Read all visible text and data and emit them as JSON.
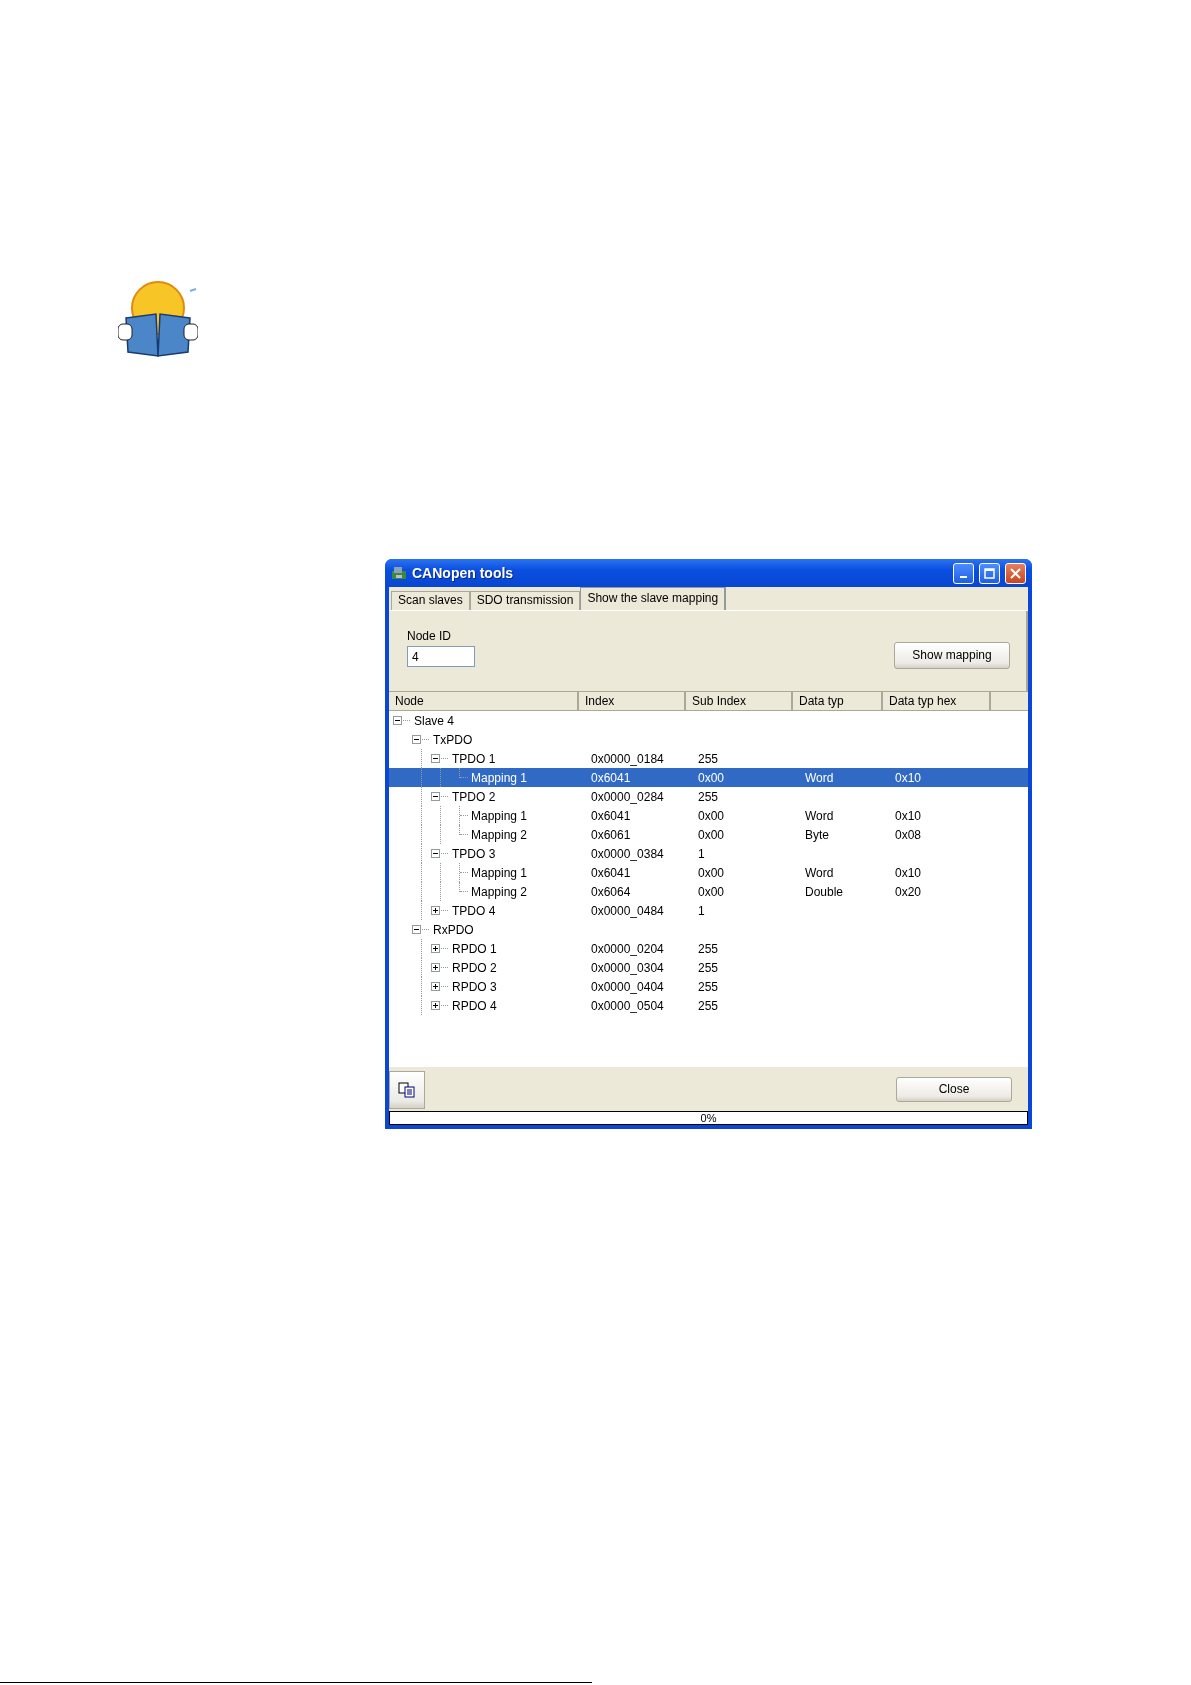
{
  "window": {
    "title": "CANopen tools"
  },
  "tabs": [
    {
      "label": "Scan slaves",
      "selected": false
    },
    {
      "label": "SDO transmission",
      "selected": false
    },
    {
      "label": "Show the slave mapping",
      "selected": true
    }
  ],
  "node_id": {
    "label": "Node ID",
    "value": "4"
  },
  "show_mapping_button": "Show mapping",
  "table": {
    "columns": [
      "Node",
      "Index",
      "Sub Index",
      "Data typ",
      "Data typ hex"
    ],
    "rows": [
      {
        "node": "Slave 4",
        "expanded": true,
        "selected": false,
        "children": [
          {
            "node": "TxPDO",
            "expanded": true,
            "selected": false,
            "children": [
              {
                "node": "TPDO 1",
                "index": "0x0000_0184",
                "sub_index": "255",
                "expanded": true,
                "selected": false,
                "children": [
                  {
                    "node": "Mapping 1",
                    "index": "0x6041",
                    "sub_index": "0x00",
                    "data_typ": "Word",
                    "data_typ_hex": "0x10",
                    "selected": true
                  }
                ]
              },
              {
                "node": "TPDO 2",
                "index": "0x0000_0284",
                "sub_index": "255",
                "expanded": true,
                "selected": false,
                "children": [
                  {
                    "node": "Mapping 1",
                    "index": "0x6041",
                    "sub_index": "0x00",
                    "data_typ": "Word",
                    "data_typ_hex": "0x10",
                    "selected": false
                  },
                  {
                    "node": "Mapping 2",
                    "index": "0x6061",
                    "sub_index": "0x00",
                    "data_typ": "Byte",
                    "data_typ_hex": "0x08",
                    "selected": false
                  }
                ]
              },
              {
                "node": "TPDO 3",
                "index": "0x0000_0384",
                "sub_index": "1",
                "expanded": true,
                "selected": false,
                "children": [
                  {
                    "node": "Mapping 1",
                    "index": "0x6041",
                    "sub_index": "0x00",
                    "data_typ": "Word",
                    "data_typ_hex": "0x10",
                    "selected": false
                  },
                  {
                    "node": "Mapping 2",
                    "index": "0x6064",
                    "sub_index": "0x00",
                    "data_typ": "Double",
                    "data_typ_hex": "0x20",
                    "selected": false
                  }
                ]
              },
              {
                "node": "TPDO 4",
                "index": "0x0000_0484",
                "sub_index": "1",
                "expanded": false,
                "selected": false
              }
            ]
          },
          {
            "node": "RxPDO",
            "expanded": true,
            "selected": false,
            "children": [
              {
                "node": "RPDO 1",
                "index": "0x0000_0204",
                "sub_index": "255",
                "expanded": false,
                "selected": false
              },
              {
                "node": "RPDO 2",
                "index": "0x0000_0304",
                "sub_index": "255",
                "expanded": false,
                "selected": false
              },
              {
                "node": "RPDO 3",
                "index": "0x0000_0404",
                "sub_index": "255",
                "expanded": false,
                "selected": false
              },
              {
                "node": "RPDO 4",
                "index": "0x0000_0504",
                "sub_index": "255",
                "expanded": false,
                "selected": false
              }
            ]
          }
        ]
      }
    ]
  },
  "close_button": "Close",
  "progress": {
    "level": 0,
    "text": "0%"
  }
}
